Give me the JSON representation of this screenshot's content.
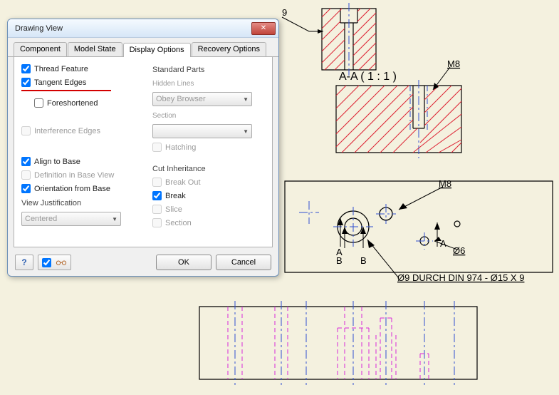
{
  "dialog": {
    "title": "Drawing View",
    "tabs": {
      "component": "Component",
      "model_state": "Model State",
      "display_options": "Display Options",
      "recovery_options": "Recovery Options"
    },
    "left": {
      "thread_feature": "Thread Feature",
      "tangent_edges": "Tangent Edges",
      "foreshortened": "Foreshortened",
      "interference_edges": "Interference Edges",
      "align_to_base": "Align to Base",
      "definition_in_base_view": "Definition in Base View",
      "orientation_from_base": "Orientation from Base",
      "view_justification": "View Justification",
      "centered": "Centered"
    },
    "right": {
      "standard_parts": "Standard Parts",
      "hidden_lines": "Hidden Lines",
      "obey_browser": "Obey Browser",
      "section": "Section",
      "hatching": "Hatching",
      "cut_inheritance": "Cut Inheritance",
      "break_out": "Break Out",
      "break": "Break",
      "slice": "Slice",
      "section2": "Section"
    },
    "buttons": {
      "ok": "OK",
      "cancel": "Cancel"
    }
  },
  "cad": {
    "section_label": "A-A ( 1 : 1 )",
    "m8": "M8",
    "m8_2": "M8",
    "a1": "A",
    "a2": "A",
    "b1": "B",
    "b2": "B",
    "phi6": "Ø6",
    "callout": "Ø9 DURCH DIN 974 - Ø15 X 9",
    "top_dim": "9"
  }
}
